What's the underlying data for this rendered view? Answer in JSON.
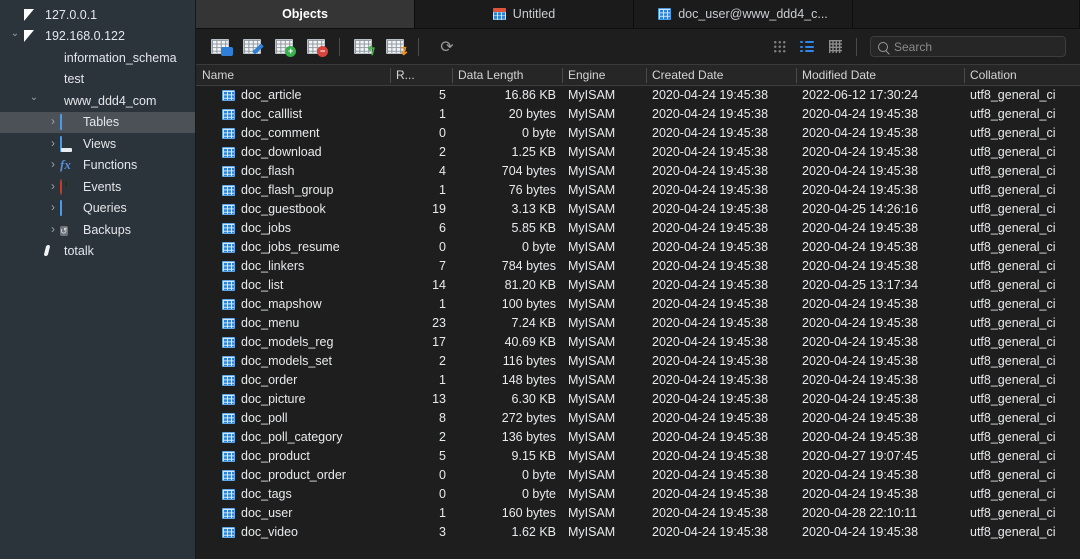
{
  "sidebar": {
    "items": [
      {
        "label": "127.0.0.1",
        "icon": "connection-icon",
        "indent": 0,
        "twisty": "none",
        "connected": false,
        "selected": false
      },
      {
        "label": "192.168.0.122",
        "icon": "connection-icon",
        "indent": 0,
        "twisty": "open",
        "connected": true,
        "selected": false
      },
      {
        "label": "information_schema",
        "icon": "database-icon",
        "indent": 1,
        "twisty": "none",
        "active": false,
        "selected": false
      },
      {
        "label": "test",
        "icon": "database-icon",
        "indent": 1,
        "twisty": "none",
        "active": false,
        "selected": false
      },
      {
        "label": "www_ddd4_com",
        "icon": "database-icon",
        "indent": 1,
        "twisty": "open",
        "active": true,
        "selected": false
      },
      {
        "label": "Tables",
        "icon": "tables-icon",
        "indent": 2,
        "twisty": "closed",
        "selected": true
      },
      {
        "label": "Views",
        "icon": "views-icon",
        "indent": 2,
        "twisty": "closed",
        "selected": false
      },
      {
        "label": "Functions",
        "icon": "functions-icon",
        "indent": 2,
        "twisty": "closed",
        "selected": false
      },
      {
        "label": "Events",
        "icon": "events-clock-icon",
        "indent": 2,
        "twisty": "closed",
        "selected": false
      },
      {
        "label": "Queries",
        "icon": "queries-icon",
        "indent": 2,
        "twisty": "closed",
        "selected": false
      },
      {
        "label": "Backups",
        "icon": "backups-icon",
        "indent": 2,
        "twisty": "closed",
        "selected": false
      },
      {
        "label": "totalk",
        "icon": "feather-icon",
        "indent": 1,
        "twisty": "none",
        "selected": false
      }
    ]
  },
  "tabs": [
    {
      "label": "Objects",
      "icon": "none",
      "active": true
    },
    {
      "label": "Untitled",
      "icon": "query-icon",
      "active": false
    },
    {
      "label": "doc_user@www_ddd4_c...",
      "icon": "table-icon",
      "active": false
    }
  ],
  "toolbar": {
    "buttons": [
      {
        "name": "open-table-button",
        "icon": "table-open-icon",
        "label": "Open Table"
      },
      {
        "name": "design-table-button",
        "icon": "table-design-icon",
        "label": "Design Table"
      },
      {
        "name": "new-table-button",
        "icon": "table-new-icon",
        "label": "New Table"
      },
      {
        "name": "delete-table-button",
        "icon": "table-delete-icon",
        "label": "Delete Table"
      },
      {
        "name": "import-wizard-button",
        "icon": "table-import-icon",
        "label": "Import Wizard"
      },
      {
        "name": "export-wizard-button",
        "icon": "table-export-icon",
        "label": "Export Wizard"
      }
    ],
    "refresh_label": "Refresh",
    "view_modes": [
      {
        "name": "icon-view-button",
        "icon": "grid-dots-icon",
        "active": false
      },
      {
        "name": "list-view-button",
        "icon": "list-icon",
        "active": true
      },
      {
        "name": "detail-view-button",
        "icon": "hash-grid-icon",
        "active": false
      }
    ]
  },
  "search": {
    "placeholder": "Search",
    "value": ""
  },
  "table": {
    "columns": [
      "Name",
      "R...",
      "Data Length",
      "Engine",
      "Created Date",
      "Modified Date",
      "Collation"
    ],
    "rows": [
      {
        "name": "doc_article",
        "rows": "5",
        "length": "16.86 KB",
        "engine": "MyISAM",
        "created": "2020-04-24 19:45:38",
        "modified": "2022-06-12 17:30:24",
        "collation": "utf8_general_ci"
      },
      {
        "name": "doc_calllist",
        "rows": "1",
        "length": "20 bytes",
        "engine": "MyISAM",
        "created": "2020-04-24 19:45:38",
        "modified": "2020-04-24 19:45:38",
        "collation": "utf8_general_ci"
      },
      {
        "name": "doc_comment",
        "rows": "0",
        "length": "0 byte",
        "engine": "MyISAM",
        "created": "2020-04-24 19:45:38",
        "modified": "2020-04-24 19:45:38",
        "collation": "utf8_general_ci"
      },
      {
        "name": "doc_download",
        "rows": "2",
        "length": "1.25 KB",
        "engine": "MyISAM",
        "created": "2020-04-24 19:45:38",
        "modified": "2020-04-24 19:45:38",
        "collation": "utf8_general_ci"
      },
      {
        "name": "doc_flash",
        "rows": "4",
        "length": "704 bytes",
        "engine": "MyISAM",
        "created": "2020-04-24 19:45:38",
        "modified": "2020-04-24 19:45:38",
        "collation": "utf8_general_ci"
      },
      {
        "name": "doc_flash_group",
        "rows": "1",
        "length": "76 bytes",
        "engine": "MyISAM",
        "created": "2020-04-24 19:45:38",
        "modified": "2020-04-24 19:45:38",
        "collation": "utf8_general_ci"
      },
      {
        "name": "doc_guestbook",
        "rows": "19",
        "length": "3.13 KB",
        "engine": "MyISAM",
        "created": "2020-04-24 19:45:38",
        "modified": "2020-04-25 14:26:16",
        "collation": "utf8_general_ci"
      },
      {
        "name": "doc_jobs",
        "rows": "6",
        "length": "5.85 KB",
        "engine": "MyISAM",
        "created": "2020-04-24 19:45:38",
        "modified": "2020-04-24 19:45:38",
        "collation": "utf8_general_ci"
      },
      {
        "name": "doc_jobs_resume",
        "rows": "0",
        "length": "0 byte",
        "engine": "MyISAM",
        "created": "2020-04-24 19:45:38",
        "modified": "2020-04-24 19:45:38",
        "collation": "utf8_general_ci"
      },
      {
        "name": "doc_linkers",
        "rows": "7",
        "length": "784 bytes",
        "engine": "MyISAM",
        "created": "2020-04-24 19:45:38",
        "modified": "2020-04-24 19:45:38",
        "collation": "utf8_general_ci"
      },
      {
        "name": "doc_list",
        "rows": "14",
        "length": "81.20 KB",
        "engine": "MyISAM",
        "created": "2020-04-24 19:45:38",
        "modified": "2020-04-25 13:17:34",
        "collation": "utf8_general_ci"
      },
      {
        "name": "doc_mapshow",
        "rows": "1",
        "length": "100 bytes",
        "engine": "MyISAM",
        "created": "2020-04-24 19:45:38",
        "modified": "2020-04-24 19:45:38",
        "collation": "utf8_general_ci"
      },
      {
        "name": "doc_menu",
        "rows": "23",
        "length": "7.24 KB",
        "engine": "MyISAM",
        "created": "2020-04-24 19:45:38",
        "modified": "2020-04-24 19:45:38",
        "collation": "utf8_general_ci"
      },
      {
        "name": "doc_models_reg",
        "rows": "17",
        "length": "40.69 KB",
        "engine": "MyISAM",
        "created": "2020-04-24 19:45:38",
        "modified": "2020-04-24 19:45:38",
        "collation": "utf8_general_ci"
      },
      {
        "name": "doc_models_set",
        "rows": "2",
        "length": "116 bytes",
        "engine": "MyISAM",
        "created": "2020-04-24 19:45:38",
        "modified": "2020-04-24 19:45:38",
        "collation": "utf8_general_ci"
      },
      {
        "name": "doc_order",
        "rows": "1",
        "length": "148 bytes",
        "engine": "MyISAM",
        "created": "2020-04-24 19:45:38",
        "modified": "2020-04-24 19:45:38",
        "collation": "utf8_general_ci"
      },
      {
        "name": "doc_picture",
        "rows": "13",
        "length": "6.30 KB",
        "engine": "MyISAM",
        "created": "2020-04-24 19:45:38",
        "modified": "2020-04-24 19:45:38",
        "collation": "utf8_general_ci"
      },
      {
        "name": "doc_poll",
        "rows": "8",
        "length": "272 bytes",
        "engine": "MyISAM",
        "created": "2020-04-24 19:45:38",
        "modified": "2020-04-24 19:45:38",
        "collation": "utf8_general_ci"
      },
      {
        "name": "doc_poll_category",
        "rows": "2",
        "length": "136 bytes",
        "engine": "MyISAM",
        "created": "2020-04-24 19:45:38",
        "modified": "2020-04-24 19:45:38",
        "collation": "utf8_general_ci"
      },
      {
        "name": "doc_product",
        "rows": "5",
        "length": "9.15 KB",
        "engine": "MyISAM",
        "created": "2020-04-24 19:45:38",
        "modified": "2020-04-27 19:07:45",
        "collation": "utf8_general_ci"
      },
      {
        "name": "doc_product_order",
        "rows": "0",
        "length": "0 byte",
        "engine": "MyISAM",
        "created": "2020-04-24 19:45:38",
        "modified": "2020-04-24 19:45:38",
        "collation": "utf8_general_ci"
      },
      {
        "name": "doc_tags",
        "rows": "0",
        "length": "0 byte",
        "engine": "MyISAM",
        "created": "2020-04-24 19:45:38",
        "modified": "2020-04-24 19:45:38",
        "collation": "utf8_general_ci"
      },
      {
        "name": "doc_user",
        "rows": "1",
        "length": "160 bytes",
        "engine": "MyISAM",
        "created": "2020-04-24 19:45:38",
        "modified": "2020-04-28 22:10:11",
        "collation": "utf8_general_ci"
      },
      {
        "name": "doc_video",
        "rows": "3",
        "length": "1.62 KB",
        "engine": "MyISAM",
        "created": "2020-04-24 19:45:38",
        "modified": "2020-04-24 19:45:38",
        "collation": "utf8_general_ci"
      }
    ]
  },
  "colors": {
    "sidebar_bg": "#2b333b",
    "main_bg": "#1e1e1e",
    "accent_blue": "#2f7fd6",
    "connected_green": "#3cc042",
    "selection": "#4c5157"
  }
}
